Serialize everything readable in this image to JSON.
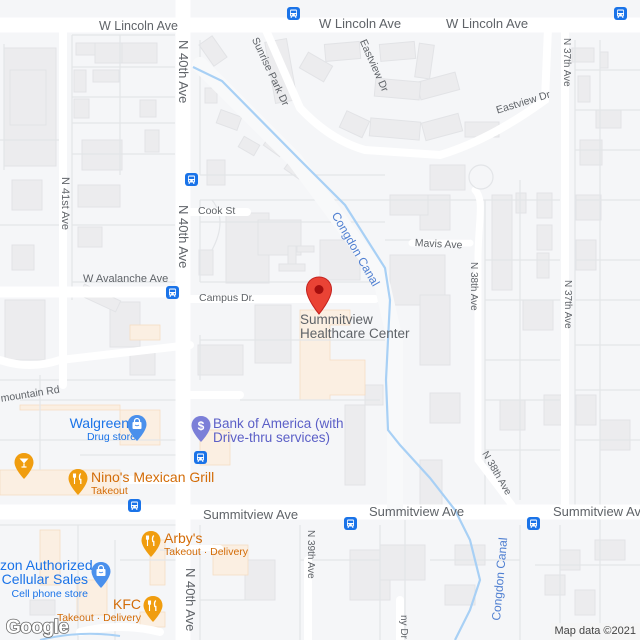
{
  "map": {
    "streets": {
      "w_lincoln_ave_1": "W Lincoln Ave",
      "w_lincoln_ave_2": "W Lincoln Ave",
      "sunrise_park_dr": "Sunrise Park Dr",
      "eastview_dr_1": "Eastview Dr",
      "eastview_dr_2": "Eastview Dr",
      "n_37th_ave_1": "N 37th Ave",
      "n_37th_ave_2": "N 37th Ave",
      "n_40th_ave_1": "N 40th Ave",
      "n_40th_ave_2": "N 40th Ave",
      "n_40th_ave_3": "N 40th Ave",
      "n_41st_ave": "N 41st Ave",
      "cook_st": "Cook St",
      "mavis_ave": "Mavis Ave",
      "w_avalanche_ave": "W Avalanche Ave",
      "campus_dr": "Campus Dr.",
      "n_38th_ave_1": "N 38th Ave",
      "n_38th_ave_2": "N 38th Ave",
      "mountain_rd": "mountain Rd",
      "summitview_ave_1": "Summitview Ave",
      "summitview_ave_2": "Summitview Ave",
      "summitview_ave_3": "Summitview Ave",
      "n_39th_ave": "N 39th Ave",
      "partial_dr": "ny Dr"
    },
    "water": {
      "congdon_canal_1": "Congdon Canal",
      "congdon_canal_2": "Congdon Canal"
    },
    "selected_place": {
      "name_line1": "Summitview",
      "name_line2": "Healthcare Center",
      "marker_color": "#ea4335"
    },
    "pois": [
      {
        "name": "Bank of America (with",
        "name2": "Drive-thru services)",
        "icon": "bank-dollar-icon",
        "color": "#5b5fc7"
      },
      {
        "name": "Walgreens",
        "sub": "Drug store",
        "icon": "shopping-bag-icon",
        "color": "#1a73e8"
      },
      {
        "name": "Nino's Mexican Grill",
        "sub": "Takeout",
        "icon": "fork-knife-icon",
        "color": "#e8890c"
      },
      {
        "name": "Arby's",
        "sub": "Takeout · Delivery",
        "icon": "fork-knife-icon",
        "color": "#e8890c"
      },
      {
        "name": "KFC",
        "sub": "Takeout · Delivery",
        "icon": "fork-knife-icon",
        "color": "#e8890c"
      },
      {
        "name": "zon Authorized",
        "name2": "Cellular Sales",
        "sub": "Cell phone store",
        "icon": "shopping-bag-icon",
        "color": "#1a73e8"
      },
      {
        "name": "",
        "icon": "cocktail-icon",
        "color": "#e8890c"
      }
    ],
    "transit_icon": "bus-stop-icon",
    "transit_color": "#1a73e8"
  },
  "footer": {
    "logo": "Google",
    "attribution": "Map data ©2021"
  }
}
